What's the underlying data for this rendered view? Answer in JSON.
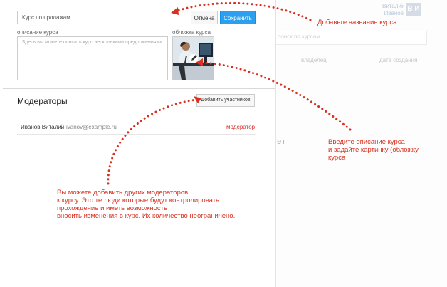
{
  "background_page": {
    "user_name": "Виталий Иванов",
    "user_initials": "В И",
    "search_placeholder": "поиск по курсам",
    "columns": [
      "владелец",
      "дата создания"
    ],
    "empty_text": "нет"
  },
  "panel": {
    "course_name_value": "Курс по продажам",
    "cancel_label": "Отмена",
    "save_label": "Сохранить",
    "description_label": "описание курса",
    "description_placeholder": "Здесь вы можете описать курс несколькими предложениями",
    "cover_label": "обложка курса",
    "moderators_title": "Модераторы",
    "add_members_label": "Добавить участников",
    "moderators": [
      {
        "name": "Иванов Виталий",
        "email": "ivanov@example.ru",
        "role": "модератор"
      }
    ]
  },
  "annotations": {
    "add_name": "Добавьте название курса",
    "description_lines": [
      "Введите описание курса",
      "и задайте картинку (обложку",
      "курса"
    ],
    "moderators_lines": [
      "Вы можете добавить других модераторов",
      "к курсу. Это те люди которые будут контролировать",
      "прохождение и иметь возможность",
      "вносить изменения в курс. Их количество неограничено."
    ]
  },
  "colors": {
    "accent": "#2b9ff0",
    "annotation": "#d9301f",
    "role": "#d9302a"
  }
}
